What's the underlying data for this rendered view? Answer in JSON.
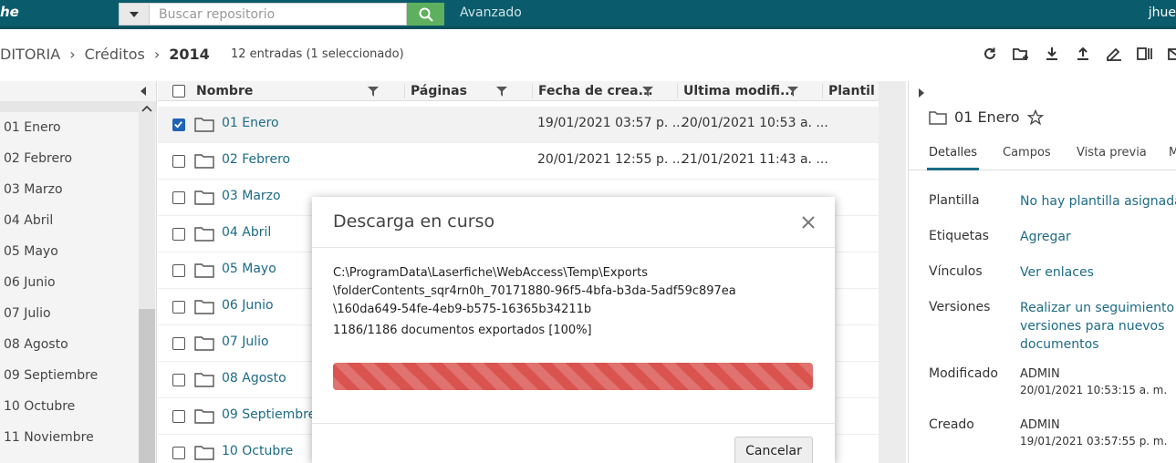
{
  "app": {
    "brand": "he",
    "user": "jhue"
  },
  "search": {
    "placeholder": "Buscar repositorio",
    "advanced_label": "Avanzado"
  },
  "breadcrumb": {
    "items": [
      "DITORIA",
      "Créditos"
    ],
    "current": "2014"
  },
  "entries_text": "12 entradas (1 seleccionado)",
  "tree": {
    "items": [
      "01 Enero",
      "02 Febrero",
      "03 Marzo",
      "04 Abril",
      "05 Mayo",
      "06 Junio",
      "07 Julio",
      "08 Agosto",
      "09 Septiembre",
      "10 Octubre",
      "11 Noviembre"
    ]
  },
  "grid": {
    "columns": {
      "name": "Nombre",
      "pages": "Páginas",
      "created": "Fecha de crea...",
      "modified": "Ultima modifi...",
      "template": "Plantill"
    },
    "rows": [
      {
        "name": "01 Enero",
        "created": "19/01/2021 03:57 p. ...",
        "modified": "20/01/2021 10:53 a. ...",
        "selected": true
      },
      {
        "name": "02 Febrero",
        "created": "20/01/2021 12:55 p. ...",
        "modified": "21/01/2021 11:43 a. ...",
        "selected": false
      },
      {
        "name": "03 Marzo",
        "created": "",
        "modified": "",
        "selected": false
      },
      {
        "name": "04 Abril",
        "created": "",
        "modified": "",
        "selected": false
      },
      {
        "name": "05 Mayo",
        "created": "",
        "modified": "",
        "selected": false
      },
      {
        "name": "06 Junio",
        "created": "",
        "modified": "",
        "selected": false
      },
      {
        "name": "07 Julio",
        "created": "",
        "modified": "",
        "selected": false
      },
      {
        "name": "08 Agosto",
        "created": "",
        "modified": "",
        "selected": false
      },
      {
        "name": "09 Septiembre",
        "created": "",
        "modified": "",
        "selected": false
      },
      {
        "name": "10 Octubre",
        "created": "",
        "modified": "",
        "selected": false
      }
    ]
  },
  "panel": {
    "title": "01 Enero",
    "tabs": [
      "Detalles",
      "Campos",
      "Vista previa",
      "M"
    ],
    "template_label": "Plantilla",
    "template_value": "No hay plantilla asignada",
    "tags_label": "Etiquetas",
    "tags_value": "Agregar",
    "links_label": "Vínculos",
    "links_value": "Ver enlaces",
    "versions_label": "Versiones",
    "versions_value_1": "Realizar un seguimiento de",
    "versions_value_2": "versiones para nuevos",
    "versions_value_3": "documentos",
    "modified_label": "Modificado",
    "modified_by": "ADMIN",
    "modified_date": "20/01/2021 10:53:15 a. m.",
    "created_label": "Creado",
    "created_by": "ADMIN",
    "created_date": "19/01/2021 03:57:55 p. m."
  },
  "dialog": {
    "title": "Descarga en curso",
    "path_line_1": "C:\\ProgramData\\Laserfiche\\WebAccess\\Temp\\Exports",
    "path_line_2": "\\folderContents_sqr4rn0h_70171880-96f5-4bfa-b3da-5adf59c897ea",
    "path_line_3": "\\160da649-54fe-4eb9-b575-16365b34211b",
    "count_text": "1186/1186 documentos exportados [100%]",
    "progress_percent": 100,
    "cancel_label": "Cancelar"
  },
  "colors": {
    "topbar": "#0a5b6b",
    "link": "#1d6b86",
    "progress": "#d9534f",
    "search_button": "#5fb05e"
  }
}
